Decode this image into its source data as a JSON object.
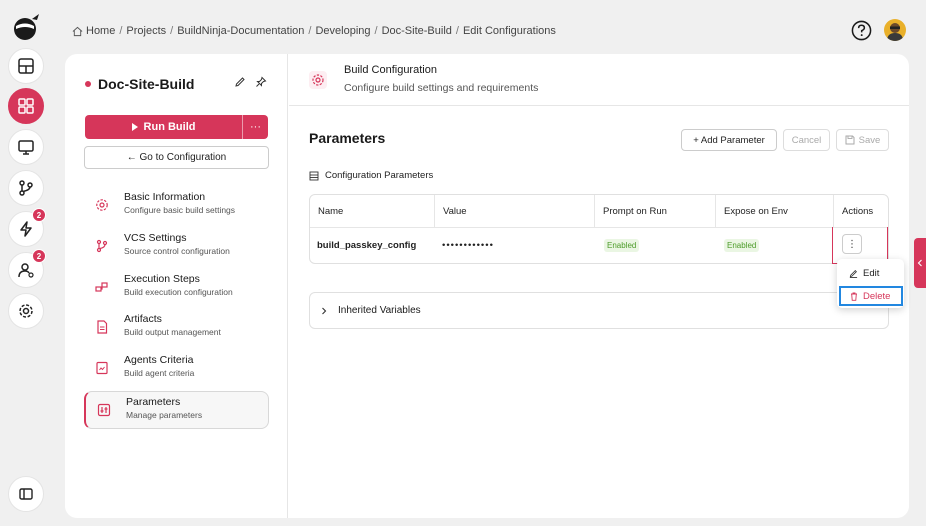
{
  "breadcrumb": [
    "Home",
    "Projects",
    "BuildNinja-Documentation",
    "Developing",
    "Doc-Site-Build",
    "Edit Configurations"
  ],
  "rail": {
    "badges": [
      "2",
      "2"
    ]
  },
  "sidebar": {
    "project_title": "Doc-Site-Build",
    "run_build_label": "Run Build",
    "run_more_label": "···",
    "goto_label": "← Go to Configuration",
    "items": [
      {
        "label": "Basic Information",
        "sub": "Configure basic build settings",
        "icon": "settings-icon"
      },
      {
        "label": "VCS Settings",
        "sub": "Source control configuration",
        "icon": "git-branch-icon"
      },
      {
        "label": "Execution Steps",
        "sub": "Build execution configuration",
        "icon": "steps-icon"
      },
      {
        "label": "Artifacts",
        "sub": "Build output management",
        "icon": "file-icon"
      },
      {
        "label": "Agents Criteria",
        "sub": "Build agent criteria",
        "icon": "agent-icon"
      },
      {
        "label": "Parameters",
        "sub": "Manage parameters",
        "icon": "parameters-icon"
      }
    ]
  },
  "header": {
    "title": "Build Configuration",
    "subtitle": "Configure build settings and requirements"
  },
  "parameters": {
    "title": "Parameters",
    "add_label": "+ Add Parameter",
    "cancel_label": "Cancel",
    "save_label": "Save",
    "section_label": "Configuration Parameters",
    "columns": [
      "Name",
      "Value",
      "Prompt on Run",
      "Expose on Env",
      "Actions"
    ],
    "rows": [
      {
        "name": "build_passkey_config",
        "value": "••••••••••••",
        "prompt": "Enabled",
        "expose": "Enabled"
      }
    ],
    "inherited_label": "Inherited Variables"
  },
  "menu": {
    "edit_label": "Edit",
    "delete_label": "Delete"
  },
  "colors": {
    "accent": "#d6365a",
    "highlight": "#2287e0",
    "enabled_text": "#4d9c2a"
  }
}
